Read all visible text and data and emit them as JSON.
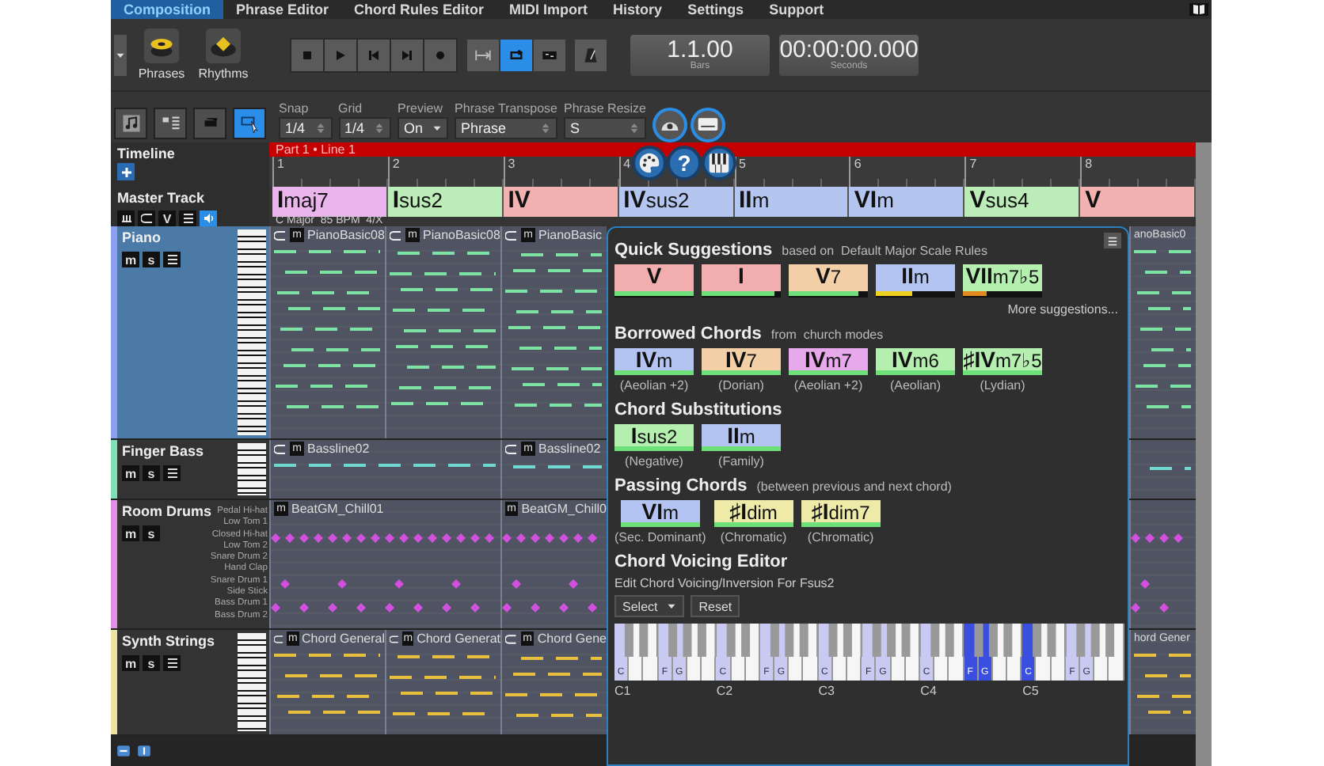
{
  "menu": {
    "tabs": [
      {
        "label": "Composition",
        "selected": true
      },
      {
        "label": "Phrase Editor",
        "selected": false
      },
      {
        "label": "Chord Rules Editor",
        "selected": false
      },
      {
        "label": "MIDI Import",
        "selected": false
      },
      {
        "label": "History",
        "selected": false
      },
      {
        "label": "Settings",
        "selected": false
      },
      {
        "label": "Support",
        "selected": false
      }
    ]
  },
  "toolbar": {
    "modes": [
      {
        "label": "Phrases",
        "kind": "phrases"
      },
      {
        "label": "Rhythms",
        "kind": "rhythms"
      }
    ],
    "transport": [
      {
        "kind": "stop"
      },
      {
        "kind": "play"
      },
      {
        "kind": "rewind"
      },
      {
        "kind": "forward"
      },
      {
        "kind": "record"
      }
    ],
    "loop_buttons": [
      {
        "kind": "range",
        "selected": false
      },
      {
        "kind": "loop",
        "selected": true
      },
      {
        "kind": "clip",
        "selected": false
      }
    ],
    "position": {
      "value": "1.1.00",
      "unit": "Bars"
    },
    "time": {
      "value": "00:00:00.000",
      "unit": "Seconds"
    }
  },
  "view_buttons": [
    {
      "kind": "notes",
      "selected": false
    },
    {
      "kind": "list",
      "selected": false
    },
    {
      "kind": "block",
      "selected": false
    },
    {
      "kind": "pointer",
      "selected": true
    }
  ],
  "fields": [
    {
      "label": "Snap",
      "value": "1/4",
      "kind": "spinner"
    },
    {
      "label": "Grid",
      "value": "1/4",
      "kind": "spinner"
    },
    {
      "label": "Preview",
      "value": "On",
      "kind": "dropdown"
    },
    {
      "label": "Phrase Transpose",
      "value": "Phrase",
      "kind": "spinner"
    },
    {
      "label": "Phrase Resize",
      "value": "S",
      "kind": "spinner"
    }
  ],
  "floating_buttons": [
    {
      "kind": "dome"
    },
    {
      "kind": "monitor"
    },
    {
      "kind": "palette"
    },
    {
      "kind": "help",
      "label": "?"
    },
    {
      "kind": "piano"
    }
  ],
  "timeline": {
    "label": "Timeline",
    "part": "Part 1 • Line 1",
    "measures": [
      "1",
      "2",
      "3",
      "4",
      "5",
      "6",
      "7",
      "8"
    ]
  },
  "master": {
    "label": "Master Track",
    "v_button": "V",
    "key_info": "C Major  85 BPM  4/X",
    "chords": [
      {
        "numeral": "I",
        "quality": "maj7",
        "color": "#eab4ec"
      },
      {
        "numeral": "I",
        "quality": "sus2",
        "color": "#bcecb8"
      },
      {
        "numeral": "IV",
        "color": "#f2b2b2"
      },
      {
        "numeral": "IV",
        "quality": "sus2",
        "color": "#b4c6ef"
      },
      {
        "numeral": "II",
        "quality": "m",
        "color": "#b4c6ef"
      },
      {
        "numeral": "VI",
        "quality": "m",
        "color": "#b4c6ef"
      },
      {
        "numeral": "V",
        "quality": "sus4",
        "color": "#bcecb8"
      },
      {
        "numeral": "V",
        "color": "#f2b2b2"
      }
    ]
  },
  "tracks": [
    {
      "name": "Piano",
      "color": "#8c9ef0",
      "selected": true,
      "kind": "melodic",
      "buttons": [
        "m",
        "s"
      ],
      "clips": [
        {
          "name": "PianoBasic08",
          "mute": "m",
          "looped": true
        },
        {
          "name": "PianoBasic08",
          "mute": "m",
          "looped": true
        },
        {
          "name": "PianoBasic",
          "mute": "m",
          "looped": true
        }
      ],
      "clips_right": [
        {
          "name": "anoBasic0"
        }
      ]
    },
    {
      "name": "Finger Bass",
      "color": "#80e0b8",
      "selected": false,
      "kind": "melodic",
      "buttons": [
        "m",
        "s"
      ],
      "clips": [
        {
          "name": "Bassline02",
          "mute": "m",
          "looped": true
        },
        {
          "name": "Bassline02",
          "mute": "m",
          "looped": true
        }
      ]
    },
    {
      "name": "Room Drums",
      "color": "#e290e4",
      "selected": false,
      "kind": "drums",
      "buttons": [
        "m",
        "s"
      ],
      "drums": [
        "Pedal Hi-hat",
        "Low Tom 1",
        "Closed Hi-hat",
        "Low Tom 2",
        "Snare Drum 2",
        "Hand Clap",
        "Snare Drum 1",
        "Side Stick",
        "Bass Drum 1",
        "Bass Drum 2"
      ],
      "clips": [
        {
          "name": "BeatGM_Chill01",
          "mute": "m",
          "looped": false
        },
        {
          "name": "BeatGM_Chill0",
          "mute": "m",
          "looped": false
        }
      ]
    },
    {
      "name": "Synth Strings",
      "color": "#eee2a2",
      "selected": false,
      "kind": "melodic",
      "buttons": [
        "m",
        "s"
      ],
      "clips": [
        {
          "name": "Chord General",
          "mute": "m",
          "looped": true
        },
        {
          "name": "Chord Generat",
          "mute": "m",
          "looped": true
        },
        {
          "name": "Chord Gene",
          "mute": "m",
          "looped": true
        }
      ],
      "clips_right": [
        {
          "name": "hord Gener"
        }
      ]
    }
  ],
  "panel": {
    "sections": [
      {
        "kind": "suggestions",
        "title": "Quick Suggestions",
        "note": "based on  Default Major Scale Rules",
        "link": "More suggestions...",
        "chords": [
          {
            "numeral": "V",
            "color": "#f2aeae",
            "level": 1
          },
          {
            "numeral": "I",
            "color": "#f2aeae",
            "level": 0.92
          },
          {
            "numeral": "V",
            "quality": "7",
            "color": "#f3cfa8",
            "level": 0.88
          },
          {
            "numeral": "II",
            "quality": "m",
            "color": "#b3c3f2",
            "level": 0.45
          },
          {
            "numeral": "VII",
            "quality": "m7♭5",
            "color": "#b5efb0",
            "level": 0.3
          }
        ]
      },
      {
        "kind": "options",
        "title": "Borrowed Chords",
        "note": "from  church modes",
        "chords": [
          {
            "numeral": "IV",
            "quality": "m",
            "color": "#b3c3f2",
            "caption": "(Aeolian +2)"
          },
          {
            "numeral": "IV",
            "quality": "7",
            "color": "#f3cfa8",
            "caption": "(Dorian)"
          },
          {
            "numeral": "IV",
            "quality": "m7",
            "color": "#e8a8ec",
            "caption": "(Aeolian +2)"
          },
          {
            "numeral": "IV",
            "quality": "m6",
            "color": "#b5efb0",
            "caption": "(Aeolian)"
          },
          {
            "numeral": "♯IV",
            "quality": "m7♭5",
            "color": "#b5efb0",
            "caption": "(Lydian)"
          }
        ]
      },
      {
        "kind": "options",
        "title": "Chord Substitutions",
        "chords": [
          {
            "numeral": "I",
            "quality": "sus2",
            "color": "#b5efb0",
            "caption": "(Negative)"
          },
          {
            "numeral": "II",
            "quality": "m",
            "color": "#b3c3f2",
            "caption": "(Family)"
          }
        ]
      },
      {
        "kind": "options",
        "title": "Passing Chords",
        "note": "(between previous and next chord)",
        "chords": [
          {
            "numeral": "VI",
            "quality": "m",
            "color": "#b3c3f2",
            "caption": "(Sec. Dominant)"
          },
          {
            "numeral": "♯I",
            "quality": "dim",
            "color": "#eeeaa8",
            "caption": "(Chromatic)"
          },
          {
            "numeral": "♯I",
            "quality": "dim7",
            "color": "#eeeaa8",
            "caption": "(Chromatic)"
          }
        ]
      },
      {
        "kind": "voicing",
        "title": "Chord Voicing Editor",
        "note": "Edit Chord Voicing/Inversion For Fsus2",
        "select": "Select",
        "reset": "Reset",
        "octaves": [
          {
            "label": "C1",
            "keys": [
              {
                "note": "C",
                "selected": false
              },
              {
                "note": "F",
                "selected": false
              },
              {
                "note": "G",
                "selected": false
              }
            ]
          },
          {
            "label": "C2",
            "keys": [
              {
                "note": "C",
                "selected": false
              },
              {
                "note": "F",
                "selected": false
              },
              {
                "note": "G",
                "selected": false
              }
            ]
          },
          {
            "label": "C3",
            "keys": [
              {
                "note": "C",
                "selected": false
              },
              {
                "note": "F",
                "selected": false
              },
              {
                "note": "G",
                "selected": false
              }
            ]
          },
          {
            "label": "C4",
            "keys": [
              {
                "note": "C",
                "selected": false
              },
              {
                "note": "F",
                "selected": true
              },
              {
                "note": "G",
                "selected": true
              }
            ]
          },
          {
            "label": "C5",
            "keys": [
              {
                "note": "C",
                "selected": true
              },
              {
                "note": "F",
                "selected": false
              },
              {
                "note": "G",
                "selected": false
              }
            ]
          }
        ]
      }
    ]
  }
}
